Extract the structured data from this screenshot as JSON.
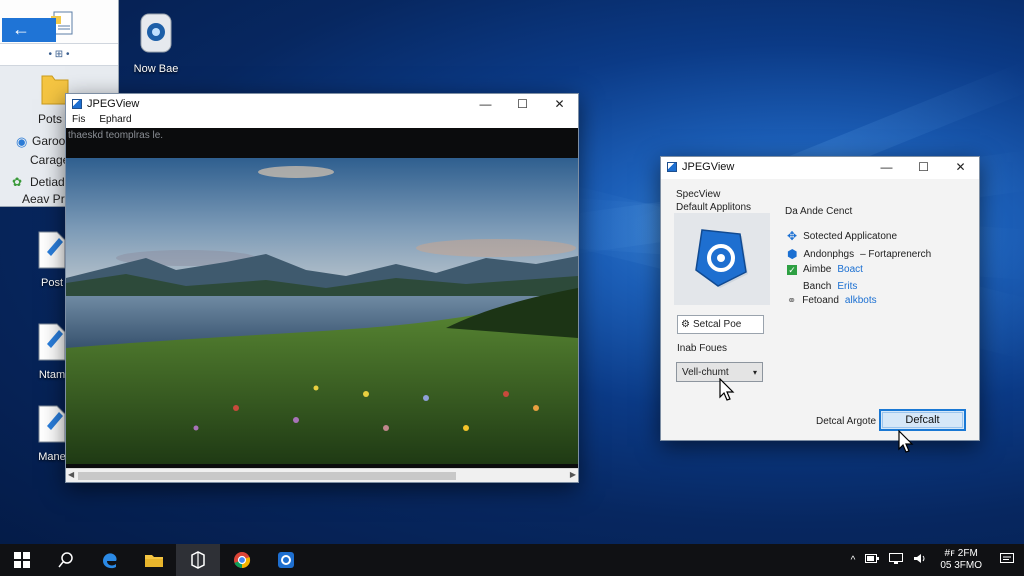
{
  "desktop": {
    "icons": [
      {
        "label": "Now Bae",
        "icon": "shield-app-icon"
      },
      {
        "label": "Post",
        "icon": "document-icon"
      },
      {
        "label": "Ntam",
        "icon": "document-icon"
      },
      {
        "label": "Mane",
        "icon": "document-icon"
      }
    ]
  },
  "explorer": {
    "nav_text": "• ⊞ •",
    "items": [
      "Pots",
      "Garoo",
      "Carage",
      "Detiad",
      "Aeav Pro"
    ]
  },
  "jpeg_window": {
    "title": "JPEGView",
    "menu": [
      "Fis",
      "Ephard"
    ],
    "caption": "thaeskd teomplras le.",
    "colors": {
      "sky_top": "#2f5f8f",
      "sky_horizon": "#b9c4cc",
      "water": "#3e5b78",
      "grass": "#3f6e2a"
    }
  },
  "dialog": {
    "title": "JPEGView",
    "heading1": "SpecView",
    "heading2": "Default Applitons",
    "right_heading": "Da Ande Cenct",
    "options": [
      {
        "icon": "arrows-icon",
        "text": "Sotected Applicatone",
        "extra": ""
      },
      {
        "icon": "shield-icon",
        "text": "Andonphgs",
        "extra": "– Fortaprenerch"
      },
      {
        "icon": "checkbox-icon",
        "text": "Aimbe",
        "extra": "Boact"
      },
      {
        "icon": "circle-icon",
        "text": "Banch",
        "extra": "Erits"
      },
      {
        "icon": "link-icon",
        "text": "Fetoand",
        "extra": "alkbots"
      }
    ],
    "select_button": "Setcal Poe",
    "label_below": "Inab Foues",
    "dropdown_value": "Vell-chumt",
    "default_label": "Detcal Argote",
    "default_button": "Defcalt",
    "accent": "#1a78d4"
  },
  "taskbar": {
    "apps": [
      "start-icon",
      "search-icon",
      "edge-icon",
      "explorer-icon",
      "store-icon",
      "chrome-icon",
      "jpegview-icon"
    ],
    "tray_chevron": "^",
    "time": "#ꜰ 2FM",
    "date": "05 3FMO"
  }
}
